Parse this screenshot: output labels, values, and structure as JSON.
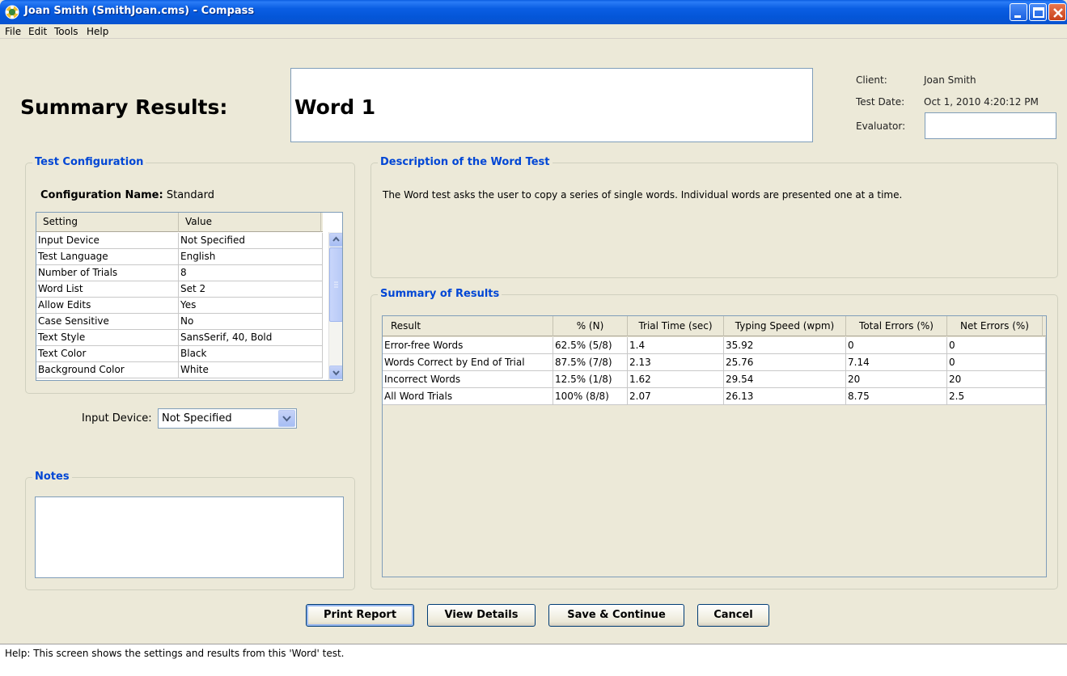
{
  "window": {
    "title": "Joan Smith (SmithJoan.cms) - Compass"
  },
  "menu": [
    "File",
    "Edit",
    "Tools",
    "Help"
  ],
  "heading": "Summary Results:",
  "test_name": "Word 1",
  "client_info": {
    "client_label": "Client:",
    "client_value": "Joan Smith",
    "test_date_label": "Test Date:",
    "test_date_value": "Oct 1, 2010 4:20:12 PM",
    "evaluator_label": "Evaluator:",
    "evaluator_value": ""
  },
  "test_configuration": {
    "title": "Test Configuration",
    "config_name_label": "Configuration Name:",
    "config_name_value": "Standard",
    "columns": [
      "Setting",
      "Value"
    ],
    "rows": [
      [
        "Input Device",
        "Not Specified"
      ],
      [
        "Test Language",
        "English"
      ],
      [
        "Number of Trials",
        "8"
      ],
      [
        "Word List",
        "Set 2"
      ],
      [
        "Allow Edits",
        "Yes"
      ],
      [
        "Case Sensitive",
        "No"
      ],
      [
        "Text Style",
        "SansSerif, 40, Bold"
      ],
      [
        "Text Color",
        "Black"
      ],
      [
        "Background Color",
        "White"
      ]
    ]
  },
  "input_device": {
    "label": "Input Device:",
    "selected": "Not Specified"
  },
  "notes": {
    "title": "Notes",
    "value": ""
  },
  "description": {
    "title": "Description of the Word Test",
    "text": "The Word test asks the user to copy a series of single words.  Individual words are presented one at a time."
  },
  "summary": {
    "title": "Summary of Results",
    "columns": [
      "Result",
      "% (N)",
      "Trial Time (sec)",
      "Typing Speed (wpm)",
      "Total Errors (%)",
      "Net Errors (%)"
    ],
    "rows": [
      [
        "Error-free Words",
        "62.5% (5/8)",
        "1.4",
        "35.92",
        "0",
        "0"
      ],
      [
        "Words Correct by End of Trial",
        "87.5% (7/8)",
        "2.13",
        "25.76",
        "7.14",
        "0"
      ],
      [
        "Incorrect Words",
        "12.5% (1/8)",
        "1.62",
        "29.54",
        "20",
        "20"
      ],
      [
        "All Word Trials",
        "100% (8/8)",
        "2.07",
        "26.13",
        "8.75",
        "2.5"
      ]
    ]
  },
  "buttons": {
    "print": "Print Report",
    "details": "View Details",
    "save": "Save & Continue",
    "cancel": "Cancel"
  },
  "status": "Help:  This screen shows the settings and results from this 'Word' test."
}
